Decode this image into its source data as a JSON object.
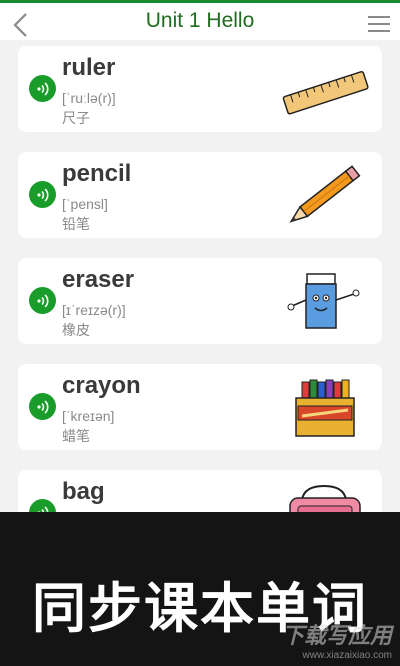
{
  "header": {
    "title": "Unit 1 Hello"
  },
  "words": [
    {
      "word": "ruler",
      "phonetic": "[ˈruːlə(r)]",
      "meaning": "尺子",
      "image": "ruler-image"
    },
    {
      "word": "pencil",
      "phonetic": "[ˈpensl]",
      "meaning": "铅笔",
      "image": "pencil-image"
    },
    {
      "word": "eraser",
      "phonetic": "[ɪˈreɪzə(r)]",
      "meaning": "橡皮",
      "image": "eraser-image"
    },
    {
      "word": "crayon",
      "phonetic": "[ˈkreɪən]",
      "meaning": "蜡笔",
      "image": "crayon-image"
    },
    {
      "word": "bag",
      "phonetic": "",
      "meaning": "",
      "image": "bag-image"
    }
  ],
  "promo": {
    "title": "同步课本单词",
    "watermark_cn": "下载写应用",
    "watermark_url": "www.xiazaixiao.com"
  },
  "colors": {
    "accent": "#1a9c2b",
    "title": "#1f6e1f",
    "promo_bg": "#141414"
  }
}
